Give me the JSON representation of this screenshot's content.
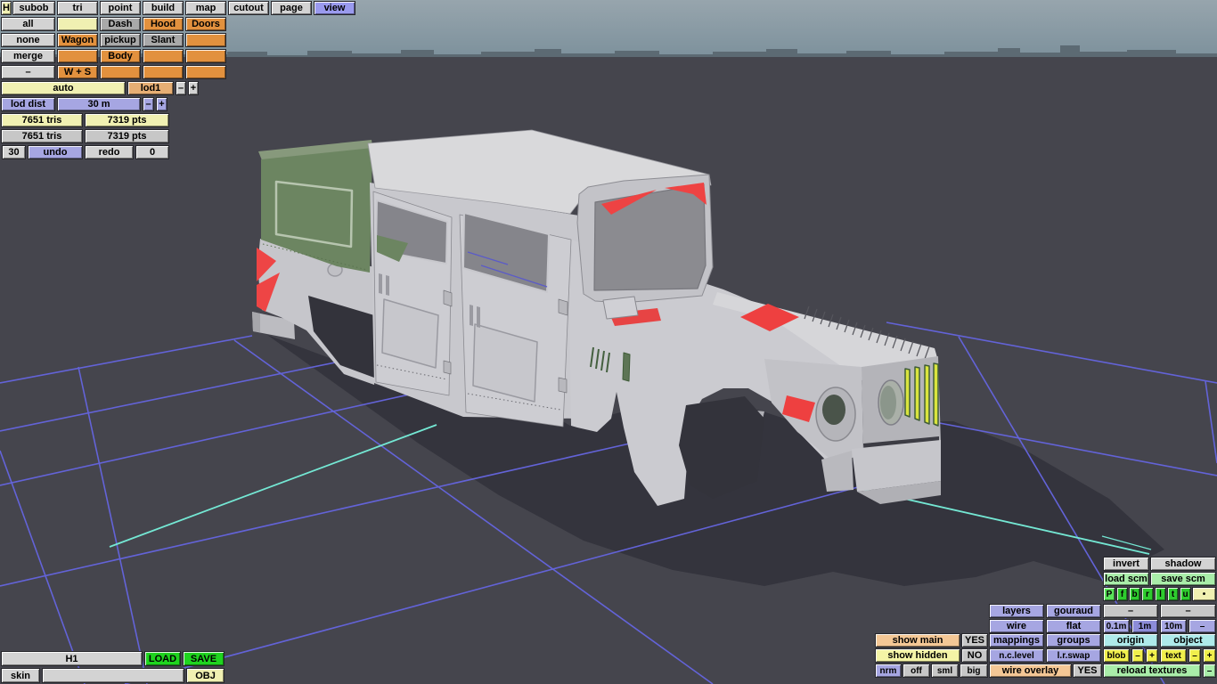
{
  "menu": [
    "H",
    "subob",
    "tri",
    "point",
    "build",
    "map",
    "cutout",
    "page",
    "view"
  ],
  "grid": {
    "all": "all",
    "none": "none",
    "merge": "merge",
    "minus": "–",
    "dash": "Dash",
    "hood": "Hood",
    "doors": "Doors",
    "wagon": "Wagon",
    "pickup": "pickup",
    "slant": "Slant",
    "body": "Body",
    "wands": "W + S"
  },
  "lod": {
    "auto": "auto",
    "lod1": "lod1",
    "minus": "–",
    "plus": "+",
    "label": "lod dist",
    "value": "30 m"
  },
  "stats": {
    "tris1": "7651 tris",
    "pts1": "7319 pts",
    "tris2": "7651 tris",
    "pts2": "7319 pts",
    "undo_steps": "30",
    "undo": "undo",
    "redo": "redo",
    "redo_steps": "0"
  },
  "file": {
    "name": "H1",
    "load": "LOAD",
    "save": "SAVE",
    "skin": "skin",
    "skin_value": "",
    "obj": "OBJ"
  },
  "br": {
    "invert": "invert",
    "shadow": "shadow",
    "load_scm": "load scm",
    "save_scm": "save scm",
    "views": [
      "P",
      "f",
      "b",
      "r",
      "l",
      "t",
      "u",
      "•"
    ],
    "layers": "layers",
    "gouraud": "gouraud",
    "d1": "–",
    "d2": "–",
    "wire": "wire",
    "flat": "flat",
    "g01": "0.1m",
    "g1": "1m",
    "g10": "10m",
    "gd": "–",
    "show_main": "show main",
    "show_main_v": "YES",
    "mappings": "mappings",
    "groups": "groups",
    "origin": "origin",
    "object": "object",
    "show_hidden": "show hidden",
    "show_hidden_v": "NO",
    "nclevel": "n.c.level",
    "lrswap": "l.r.swap",
    "blob": "blob",
    "blob_m": "–",
    "blob_p": "+",
    "text": "text",
    "text_m": "–",
    "text_p": "+",
    "nrm": "nrm",
    "off": "off",
    "sml": "sml",
    "big": "big",
    "wire_overlay": "wire overlay",
    "wire_overlay_v": "YES",
    "reload": "reload textures",
    "reload_d": "–"
  },
  "viewport": {
    "model": "humvee-body-3d-model",
    "grid_color": "#6363d8",
    "highlight_color": "#74e8d4",
    "ground_color": "#45454d",
    "shadow_color": "#34343d",
    "canopy_green": "#6c8561",
    "accent_red": "#ee4343",
    "grille_yellow": "#d9e43e"
  }
}
